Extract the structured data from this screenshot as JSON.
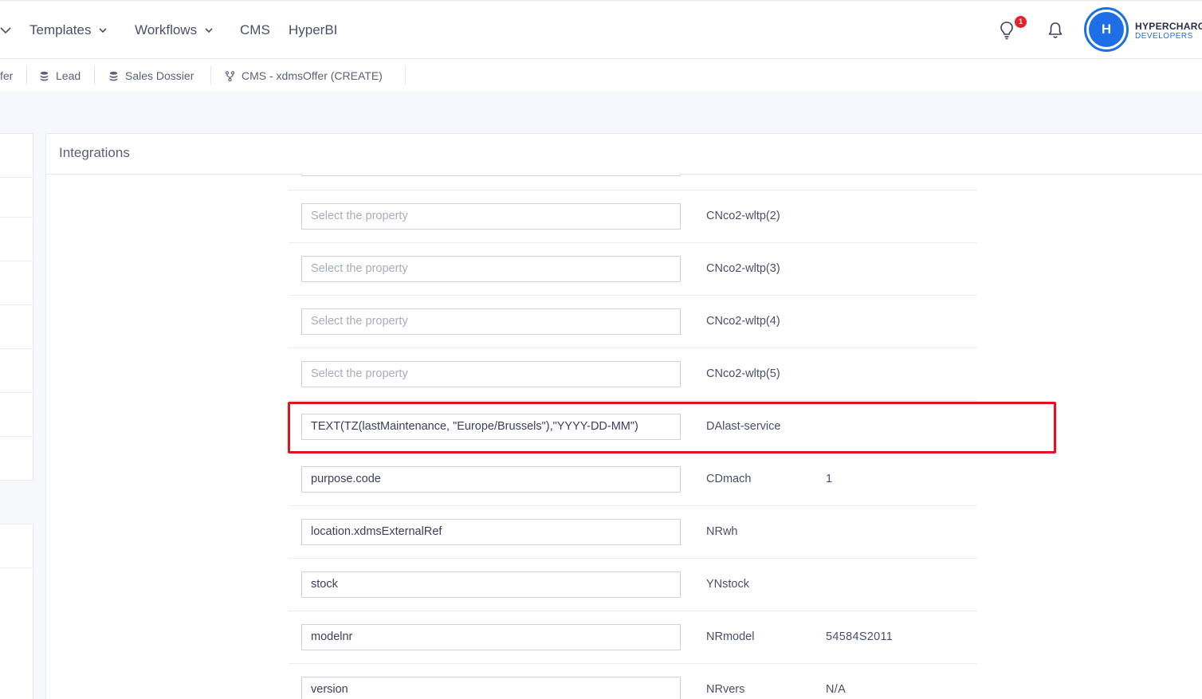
{
  "nav": {
    "items": [
      {
        "label": "Templates",
        "has_dropdown": true
      },
      {
        "label": "Workflows",
        "has_dropdown": true
      },
      {
        "label": "CMS",
        "has_dropdown": false
      },
      {
        "label": "HyperBI",
        "has_dropdown": false
      }
    ],
    "notification_badge": "1",
    "avatar_letter": "H",
    "org_name": "HYPERCHARGE",
    "org_sub": "DEVELOPERS"
  },
  "tabs": [
    {
      "label": "fer",
      "icon": "database-icon"
    },
    {
      "label": "Lead",
      "icon": "database-icon"
    },
    {
      "label": "Sales Dossier",
      "icon": "database-icon"
    },
    {
      "label": "CMS - xdmsOffer (CREATE)",
      "icon": "workflow-icon"
    }
  ],
  "card": {
    "title": "Integrations"
  },
  "mapping_rows": [
    {
      "input": "Select the property",
      "is_placeholder": true,
      "property": "CNco2-wltp(2)",
      "value": ""
    },
    {
      "input": "Select the property",
      "is_placeholder": true,
      "property": "CNco2-wltp(3)",
      "value": ""
    },
    {
      "input": "Select the property",
      "is_placeholder": true,
      "property": "CNco2-wltp(4)",
      "value": ""
    },
    {
      "input": "Select the property",
      "is_placeholder": true,
      "property": "CNco2-wltp(5)",
      "value": ""
    },
    {
      "input": "TEXT(TZ(lastMaintenance, \"Europe/Brussels\"),\"YYYY-DD-MM\")",
      "is_placeholder": false,
      "property": "DAlast-service",
      "value": ""
    },
    {
      "input": "purpose.code",
      "is_placeholder": false,
      "property": "CDmach",
      "value": "1"
    },
    {
      "input": "location.xdmsExternalRef",
      "is_placeholder": false,
      "property": "NRwh",
      "value": ""
    },
    {
      "input": "stock",
      "is_placeholder": false,
      "property": "YNstock",
      "value": ""
    },
    {
      "input": "modelnr",
      "is_placeholder": false,
      "property": "NRmodel",
      "value": "54584S2011"
    },
    {
      "input": "version",
      "is_placeholder": false,
      "property": "NRvers",
      "value": "N/A"
    }
  ],
  "colors": {
    "accent": "#1e6fe6",
    "highlight": "#e3121b",
    "badge": "#e8202a"
  }
}
